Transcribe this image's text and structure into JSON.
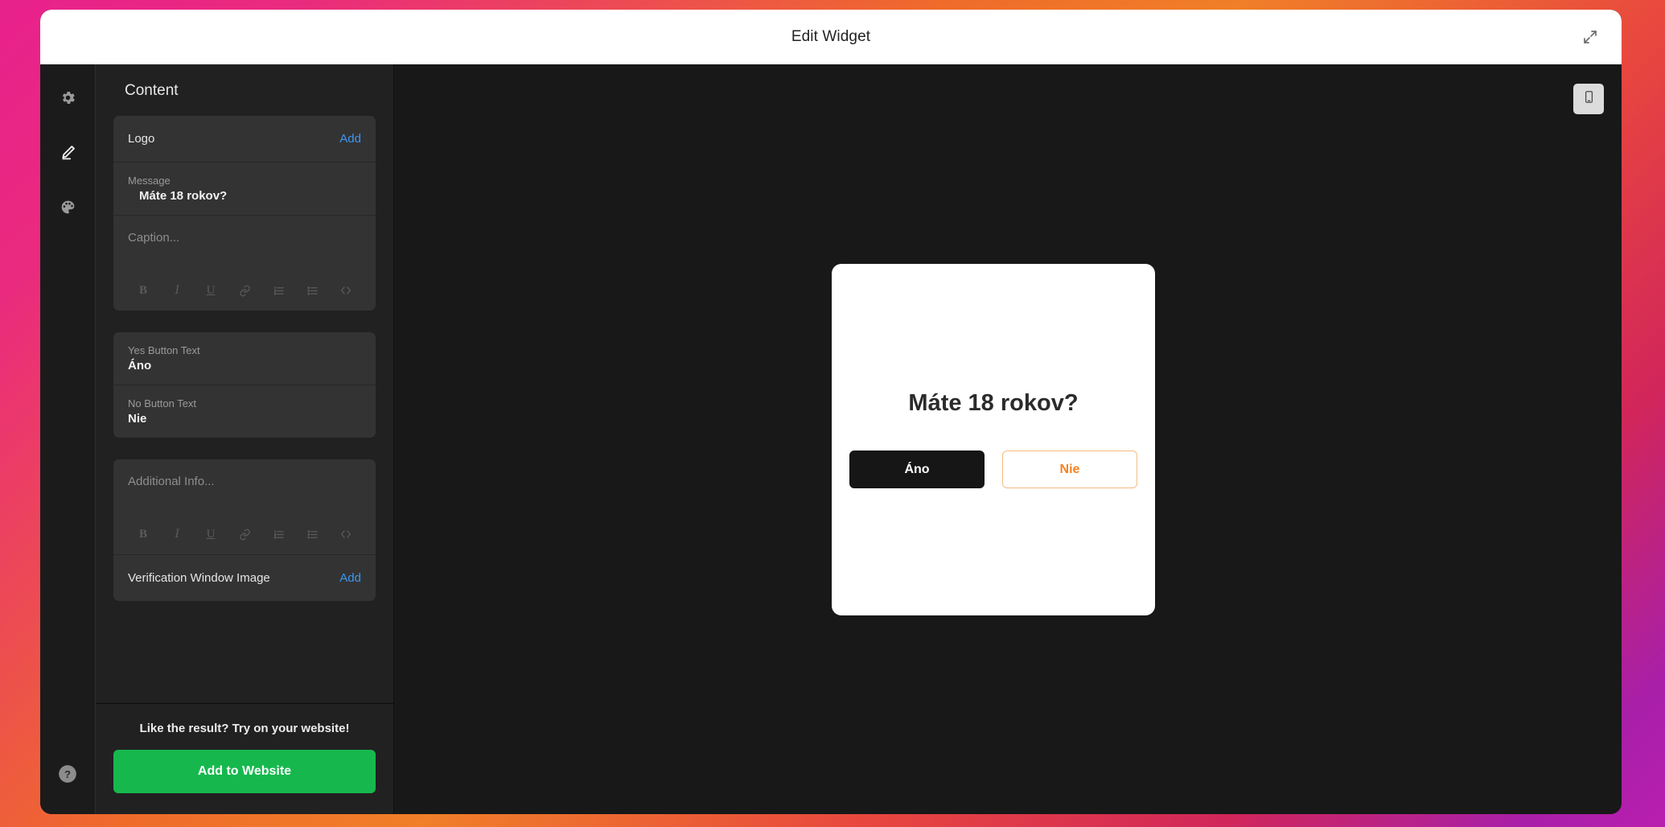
{
  "background": {
    "gradient_colors": [
      "#e8218c",
      "#ef6b2a",
      "#f07f28",
      "#e8463f",
      "#d2265a",
      "#a81fa8"
    ]
  },
  "header": {
    "title": "Edit Widget",
    "expand_icon": "expand-arrows-icon"
  },
  "icon_rail": {
    "items": [
      {
        "name": "settings",
        "icon": "gear-icon",
        "active": false
      },
      {
        "name": "content",
        "icon": "pencil-icon",
        "active": true
      },
      {
        "name": "appearance",
        "icon": "palette-icon",
        "active": false
      }
    ],
    "help": {
      "name": "help",
      "icon": "question-circle-icon"
    }
  },
  "sidebar": {
    "heading": "Content",
    "logo_field": {
      "label": "Logo",
      "action": "Add"
    },
    "message_field": {
      "label": "Message",
      "value": "Máte 18 rokov?"
    },
    "caption_field": {
      "placeholder": "Caption..."
    },
    "yes_button_field": {
      "label": "Yes Button Text",
      "value": "Áno"
    },
    "no_button_field": {
      "label": "No Button Text",
      "value": "Nie"
    },
    "additional_info_field": {
      "placeholder": "Additional Info..."
    },
    "verification_image_field": {
      "label": "Verification Window Image",
      "action": "Add"
    },
    "rte_toolbar": [
      {
        "name": "bold",
        "label": "B",
        "icon": "bold-icon"
      },
      {
        "name": "italic",
        "label": "I",
        "icon": "italic-icon"
      },
      {
        "name": "underline",
        "label": "U",
        "icon": "underline-icon"
      },
      {
        "name": "link",
        "label": "",
        "icon": "link-icon"
      },
      {
        "name": "ordered-list",
        "label": "",
        "icon": "ordered-list-icon"
      },
      {
        "name": "bullet-list",
        "label": "",
        "icon": "bullet-list-icon"
      },
      {
        "name": "code",
        "label": "",
        "icon": "code-icon"
      }
    ],
    "footer": {
      "caption": "Like the result? Try on your website!",
      "cta_label": "Add to Website",
      "cta_color": "#16b84e"
    }
  },
  "preview": {
    "device_toggle": {
      "icon": "mobile-device-icon",
      "selected": true
    },
    "widget": {
      "message": "Máte 18 rokov?",
      "yes_label": "Áno",
      "no_label": "Nie",
      "yes_bg": "#161616",
      "no_text_color": "#f58220",
      "no_border_color": "#f6bc80",
      "card_bg": "#ffffff"
    }
  }
}
